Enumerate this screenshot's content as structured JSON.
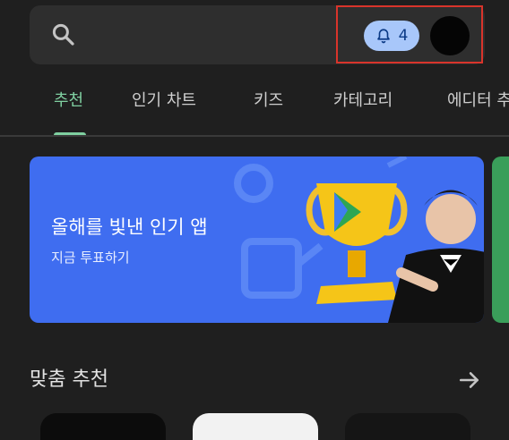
{
  "search": {
    "icon": "search-icon"
  },
  "notification": {
    "count": "4",
    "icon": "bell-icon",
    "color": "#a8c7fa"
  },
  "avatar": {
    "icon": "avatar"
  },
  "tabs": [
    {
      "label": "추천",
      "active": true
    },
    {
      "label": "인기 차트",
      "active": false
    },
    {
      "label": "키즈",
      "active": false
    },
    {
      "label": "카테고리",
      "active": false
    },
    {
      "label": "에디터 추",
      "active": false
    }
  ],
  "banner": {
    "title": "올해를 빛낸 인기 앱",
    "subtitle": "지금 투표하기",
    "background": "#3f6df0"
  },
  "section": {
    "title": "맞춤 추천",
    "arrow_icon": "arrow-right-icon"
  },
  "accent_color": "#7fcfa0"
}
